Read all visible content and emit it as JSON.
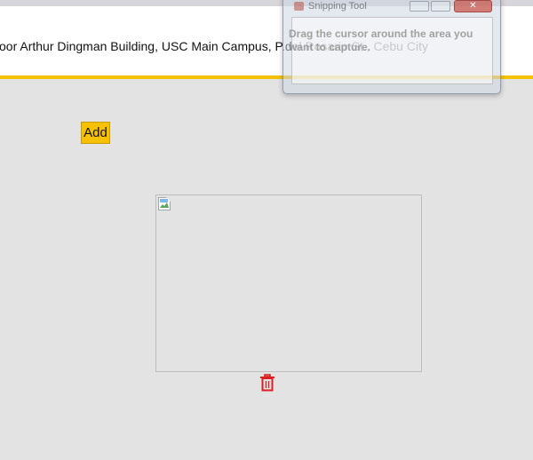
{
  "header": {
    "address": "floor Arthur Dingman Building, USC Main Campus, P.del Rosario St., Cebu City"
  },
  "actions": {
    "add_label": "Add"
  },
  "image": {
    "icon": "broken-image-icon"
  },
  "delete": {
    "icon": "trash-icon",
    "color": "#dd1f1f"
  },
  "theme": {
    "accent": "#f5c100",
    "background": "#e3e3e3"
  },
  "snipping_tool": {
    "title": "Snipping Tool",
    "message": "Drag the cursor around the area you want to capture."
  }
}
